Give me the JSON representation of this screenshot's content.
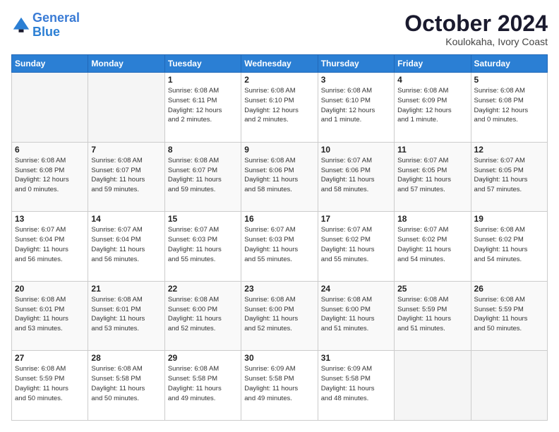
{
  "header": {
    "logo_line1": "General",
    "logo_line2": "Blue",
    "month": "October 2024",
    "location": "Koulokaha, Ivory Coast"
  },
  "weekdays": [
    "Sunday",
    "Monday",
    "Tuesday",
    "Wednesday",
    "Thursday",
    "Friday",
    "Saturday"
  ],
  "weeks": [
    [
      {
        "day": "",
        "info": ""
      },
      {
        "day": "",
        "info": ""
      },
      {
        "day": "1",
        "info": "Sunrise: 6:08 AM\nSunset: 6:11 PM\nDaylight: 12 hours\nand 2 minutes."
      },
      {
        "day": "2",
        "info": "Sunrise: 6:08 AM\nSunset: 6:10 PM\nDaylight: 12 hours\nand 2 minutes."
      },
      {
        "day": "3",
        "info": "Sunrise: 6:08 AM\nSunset: 6:10 PM\nDaylight: 12 hours\nand 1 minute."
      },
      {
        "day": "4",
        "info": "Sunrise: 6:08 AM\nSunset: 6:09 PM\nDaylight: 12 hours\nand 1 minute."
      },
      {
        "day": "5",
        "info": "Sunrise: 6:08 AM\nSunset: 6:08 PM\nDaylight: 12 hours\nand 0 minutes."
      }
    ],
    [
      {
        "day": "6",
        "info": "Sunrise: 6:08 AM\nSunset: 6:08 PM\nDaylight: 12 hours\nand 0 minutes."
      },
      {
        "day": "7",
        "info": "Sunrise: 6:08 AM\nSunset: 6:07 PM\nDaylight: 11 hours\nand 59 minutes."
      },
      {
        "day": "8",
        "info": "Sunrise: 6:08 AM\nSunset: 6:07 PM\nDaylight: 11 hours\nand 59 minutes."
      },
      {
        "day": "9",
        "info": "Sunrise: 6:08 AM\nSunset: 6:06 PM\nDaylight: 11 hours\nand 58 minutes."
      },
      {
        "day": "10",
        "info": "Sunrise: 6:07 AM\nSunset: 6:06 PM\nDaylight: 11 hours\nand 58 minutes."
      },
      {
        "day": "11",
        "info": "Sunrise: 6:07 AM\nSunset: 6:05 PM\nDaylight: 11 hours\nand 57 minutes."
      },
      {
        "day": "12",
        "info": "Sunrise: 6:07 AM\nSunset: 6:05 PM\nDaylight: 11 hours\nand 57 minutes."
      }
    ],
    [
      {
        "day": "13",
        "info": "Sunrise: 6:07 AM\nSunset: 6:04 PM\nDaylight: 11 hours\nand 56 minutes."
      },
      {
        "day": "14",
        "info": "Sunrise: 6:07 AM\nSunset: 6:04 PM\nDaylight: 11 hours\nand 56 minutes."
      },
      {
        "day": "15",
        "info": "Sunrise: 6:07 AM\nSunset: 6:03 PM\nDaylight: 11 hours\nand 55 minutes."
      },
      {
        "day": "16",
        "info": "Sunrise: 6:07 AM\nSunset: 6:03 PM\nDaylight: 11 hours\nand 55 minutes."
      },
      {
        "day": "17",
        "info": "Sunrise: 6:07 AM\nSunset: 6:02 PM\nDaylight: 11 hours\nand 55 minutes."
      },
      {
        "day": "18",
        "info": "Sunrise: 6:07 AM\nSunset: 6:02 PM\nDaylight: 11 hours\nand 54 minutes."
      },
      {
        "day": "19",
        "info": "Sunrise: 6:08 AM\nSunset: 6:02 PM\nDaylight: 11 hours\nand 54 minutes."
      }
    ],
    [
      {
        "day": "20",
        "info": "Sunrise: 6:08 AM\nSunset: 6:01 PM\nDaylight: 11 hours\nand 53 minutes."
      },
      {
        "day": "21",
        "info": "Sunrise: 6:08 AM\nSunset: 6:01 PM\nDaylight: 11 hours\nand 53 minutes."
      },
      {
        "day": "22",
        "info": "Sunrise: 6:08 AM\nSunset: 6:00 PM\nDaylight: 11 hours\nand 52 minutes."
      },
      {
        "day": "23",
        "info": "Sunrise: 6:08 AM\nSunset: 6:00 PM\nDaylight: 11 hours\nand 52 minutes."
      },
      {
        "day": "24",
        "info": "Sunrise: 6:08 AM\nSunset: 6:00 PM\nDaylight: 11 hours\nand 51 minutes."
      },
      {
        "day": "25",
        "info": "Sunrise: 6:08 AM\nSunset: 5:59 PM\nDaylight: 11 hours\nand 51 minutes."
      },
      {
        "day": "26",
        "info": "Sunrise: 6:08 AM\nSunset: 5:59 PM\nDaylight: 11 hours\nand 50 minutes."
      }
    ],
    [
      {
        "day": "27",
        "info": "Sunrise: 6:08 AM\nSunset: 5:59 PM\nDaylight: 11 hours\nand 50 minutes."
      },
      {
        "day": "28",
        "info": "Sunrise: 6:08 AM\nSunset: 5:58 PM\nDaylight: 11 hours\nand 50 minutes."
      },
      {
        "day": "29",
        "info": "Sunrise: 6:08 AM\nSunset: 5:58 PM\nDaylight: 11 hours\nand 49 minutes."
      },
      {
        "day": "30",
        "info": "Sunrise: 6:09 AM\nSunset: 5:58 PM\nDaylight: 11 hours\nand 49 minutes."
      },
      {
        "day": "31",
        "info": "Sunrise: 6:09 AM\nSunset: 5:58 PM\nDaylight: 11 hours\nand 48 minutes."
      },
      {
        "day": "",
        "info": ""
      },
      {
        "day": "",
        "info": ""
      }
    ]
  ]
}
